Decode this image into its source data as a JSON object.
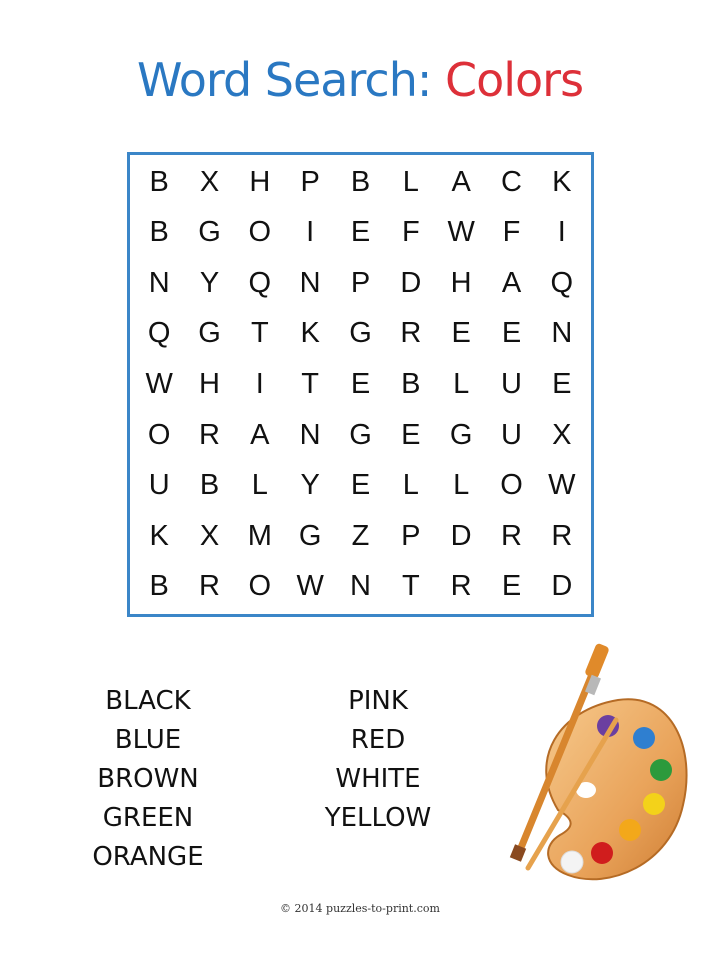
{
  "title": {
    "part1": "Word Search:",
    "part2": "Colors"
  },
  "grid": [
    [
      "B",
      "X",
      "H",
      "P",
      "B",
      "L",
      "A",
      "C",
      "K"
    ],
    [
      "B",
      "G",
      "O",
      "I",
      "E",
      "F",
      "W",
      "F",
      "I"
    ],
    [
      "N",
      "Y",
      "Q",
      "N",
      "P",
      "D",
      "H",
      "A",
      "Q"
    ],
    [
      "Q",
      "G",
      "T",
      "K",
      "G",
      "R",
      "E",
      "E",
      "N"
    ],
    [
      "W",
      "H",
      "I",
      "T",
      "E",
      "B",
      "L",
      "U",
      "E"
    ],
    [
      "O",
      "R",
      "A",
      "N",
      "G",
      "E",
      "G",
      "U",
      "X"
    ],
    [
      "U",
      "B",
      "L",
      "Y",
      "E",
      "L",
      "L",
      "O",
      "W"
    ],
    [
      "K",
      "X",
      "M",
      "G",
      "Z",
      "P",
      "D",
      "R",
      "R"
    ],
    [
      "B",
      "R",
      "O",
      "W",
      "N",
      "T",
      "R",
      "E",
      "D"
    ]
  ],
  "words_col1": [
    "BLACK",
    "BLUE",
    "BROWN",
    "GREEN",
    "ORANGE"
  ],
  "words_col2": [
    "PINK",
    "RED",
    "WHITE",
    "YELLOW"
  ],
  "footer": "© 2014 puzzles-to-print.com",
  "colors": {
    "title_blue": "#2a78c2",
    "title_red": "#dd3039",
    "frame": "#3b86c8"
  }
}
